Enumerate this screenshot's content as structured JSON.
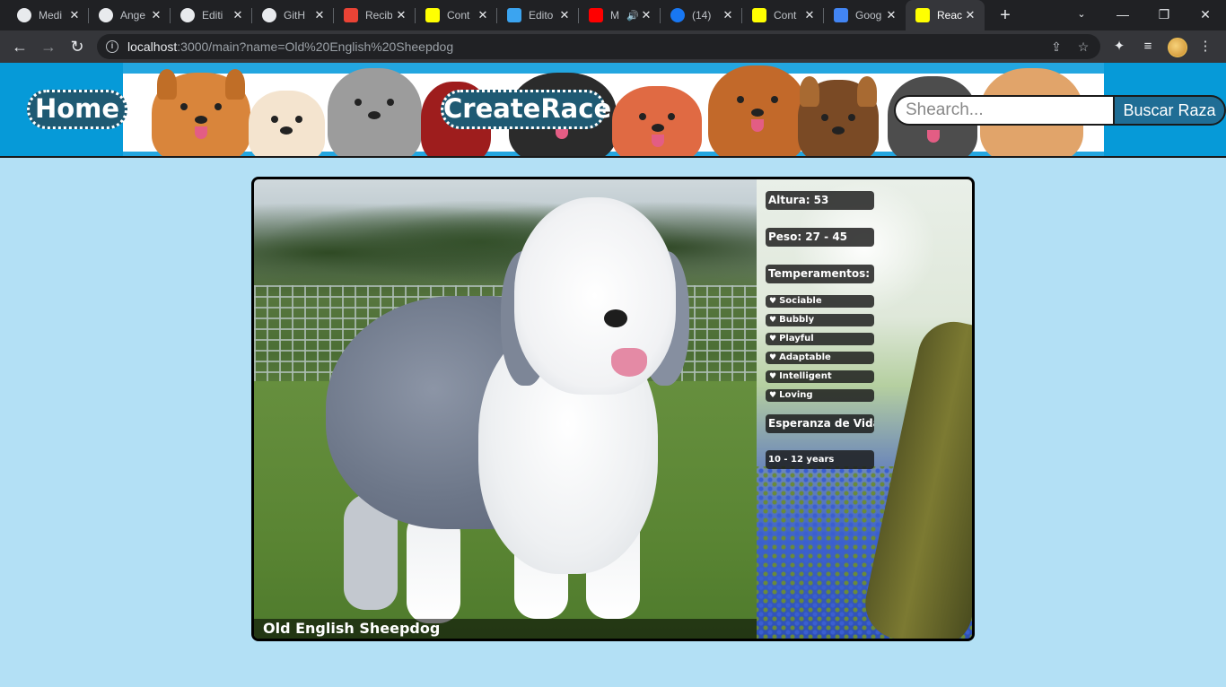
{
  "browser": {
    "tabs": [
      {
        "title": "Medi",
        "icon": "github-icon",
        "color": "#e8eaed"
      },
      {
        "title": "Ange",
        "icon": "github-icon",
        "color": "#e8eaed"
      },
      {
        "title": "Editi",
        "icon": "github-icon",
        "color": "#e8eaed"
      },
      {
        "title": "GitH",
        "icon": "github-icon",
        "color": "#e8eaed"
      },
      {
        "title": "Recib",
        "icon": "gmail-icon",
        "color": "#ea4335"
      },
      {
        "title": "Cont",
        "icon": "henry-icon",
        "color": "#ffff01"
      },
      {
        "title": "Edito",
        "icon": "medium-icon",
        "color": "#3ba4f0"
      },
      {
        "title": "M",
        "icon": "youtube-icon",
        "color": "#ff0000"
      },
      {
        "title": "(14)",
        "icon": "facebook-icon",
        "color": "#1877f2"
      },
      {
        "title": "Cont",
        "icon": "henry-icon",
        "color": "#ffff01"
      },
      {
        "title": "Goog",
        "icon": "google-translate-icon",
        "color": "#4285f4"
      },
      {
        "title": "Reac",
        "icon": "henry-icon",
        "color": "#ffff01"
      }
    ],
    "url_host": "localhost",
    "url_rest": ":3000/main?name=Old%20English%20Sheepdog"
  },
  "header": {
    "home_label": "Home",
    "create_label": "CreateRace",
    "search_placeholder": "Shearch...",
    "search_button": "Buscar Raza"
  },
  "breed": {
    "name": "Old English Sheepdog",
    "height": "Altura: 53",
    "weight": "Peso: 27 - 45",
    "temperaments_title": "Temperamentos:",
    "temperaments": [
      "Sociable",
      "Bubbly",
      "Playful",
      "Adaptable",
      "Intelligent",
      "Loving"
    ],
    "life_title": "Esperanza de Vida:",
    "life_span": "10 - 12 years"
  }
}
